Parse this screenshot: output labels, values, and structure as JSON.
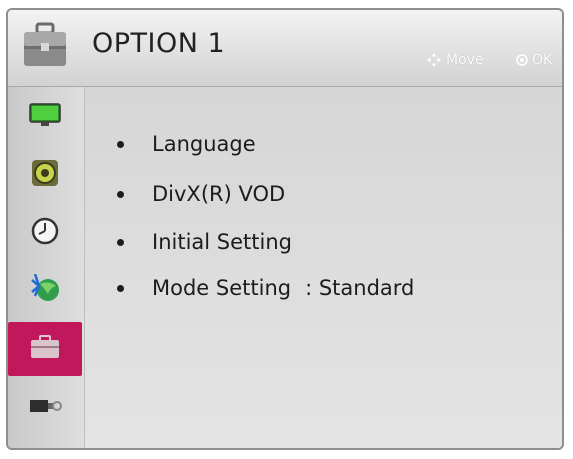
{
  "header": {
    "title": "OPTION 1",
    "hints": {
      "move": "Move",
      "ok": "OK"
    },
    "icon": "briefcase-icon"
  },
  "sidebar": {
    "items": [
      {
        "icon": "picture-tv-icon",
        "selected": false
      },
      {
        "icon": "speaker-audio-icon",
        "selected": false
      },
      {
        "icon": "clock-time-icon",
        "selected": false
      },
      {
        "icon": "network-globe-icon",
        "selected": false
      },
      {
        "icon": "option-briefcase-icon",
        "selected": true
      },
      {
        "icon": "input-device-icon",
        "selected": false
      }
    ],
    "active_color": "#c0185a"
  },
  "menu": {
    "items": [
      {
        "label": "Language"
      },
      {
        "label": "DivX(R) VOD"
      },
      {
        "label": "Initial Setting"
      },
      {
        "label": "Mode Setting",
        "value": ": Standard"
      }
    ]
  }
}
